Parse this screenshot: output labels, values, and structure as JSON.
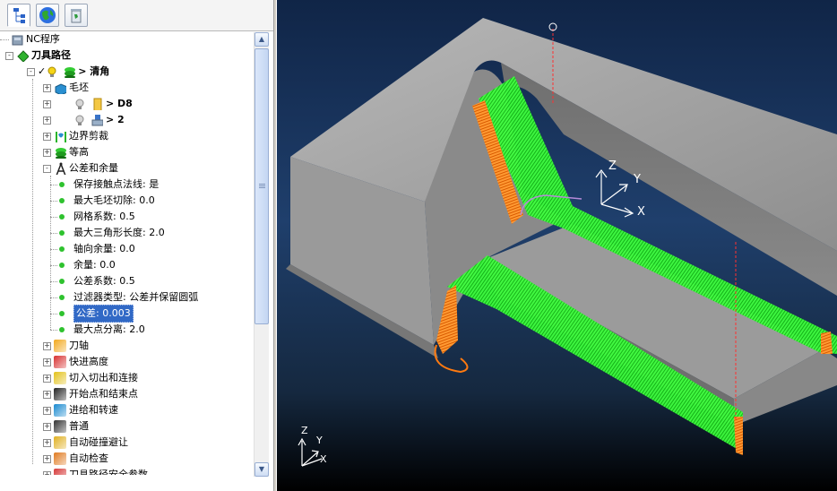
{
  "tabs": [
    {
      "name": "explorer-tab",
      "icon": "tree-icon"
    },
    {
      "name": "globe-tab",
      "icon": "globe-icon"
    },
    {
      "name": "recycle-bin-tab",
      "icon": "recycle-bin-icon"
    }
  ],
  "tree": {
    "nc_program": "NC程序",
    "toolpaths": "刀具路径",
    "clearance": "> 清角",
    "stock": "毛坯",
    "tool": "> D8",
    "tool2": "> 2",
    "boundary": "边界剪裁",
    "contour": "等高",
    "tolerance_allowance": "公差和余量",
    "params": [
      "保存接触点法线: 是",
      "最大毛坯切除: 0.0",
      "网格系数: 0.5",
      "最大三角形长度: 2.0",
      "轴向余量: 0.0",
      "余量: 0.0",
      "公差系数: 0.5",
      "过滤器类型: 公差并保留圆弧",
      "公差: 0.003",
      "最大点分离: 2.0"
    ],
    "after": [
      {
        "label": "刀轴",
        "icon": "tool-axis-icon"
      },
      {
        "label": "快进高度",
        "icon": "rapid-height-icon"
      },
      {
        "label": "切入切出和连接",
        "icon": "leads-links-icon"
      },
      {
        "label": "开始点和结束点",
        "icon": "start-end-point-icon"
      },
      {
        "label": "进给和转速",
        "icon": "feeds-speeds-icon"
      },
      {
        "label": "普通",
        "icon": "general-icon"
      },
      {
        "label": "自动碰撞避让",
        "icon": "collision-avoid-icon"
      },
      {
        "label": "自动检查",
        "icon": "auto-check-icon"
      },
      {
        "label": "刀具路径安全参数",
        "icon": "safety-params-icon"
      }
    ]
  },
  "viewport": {
    "axis_triad": {
      "z": "Z",
      "y": "Y",
      "x": "X"
    },
    "corner_triad": {
      "z": "Z",
      "y": "Y",
      "x": "X"
    },
    "colors": {
      "toolpath": "#22ee22",
      "leads": "#ff7a10",
      "part_top": "#a9a9a9",
      "part_side": "#7d7d7d"
    }
  }
}
